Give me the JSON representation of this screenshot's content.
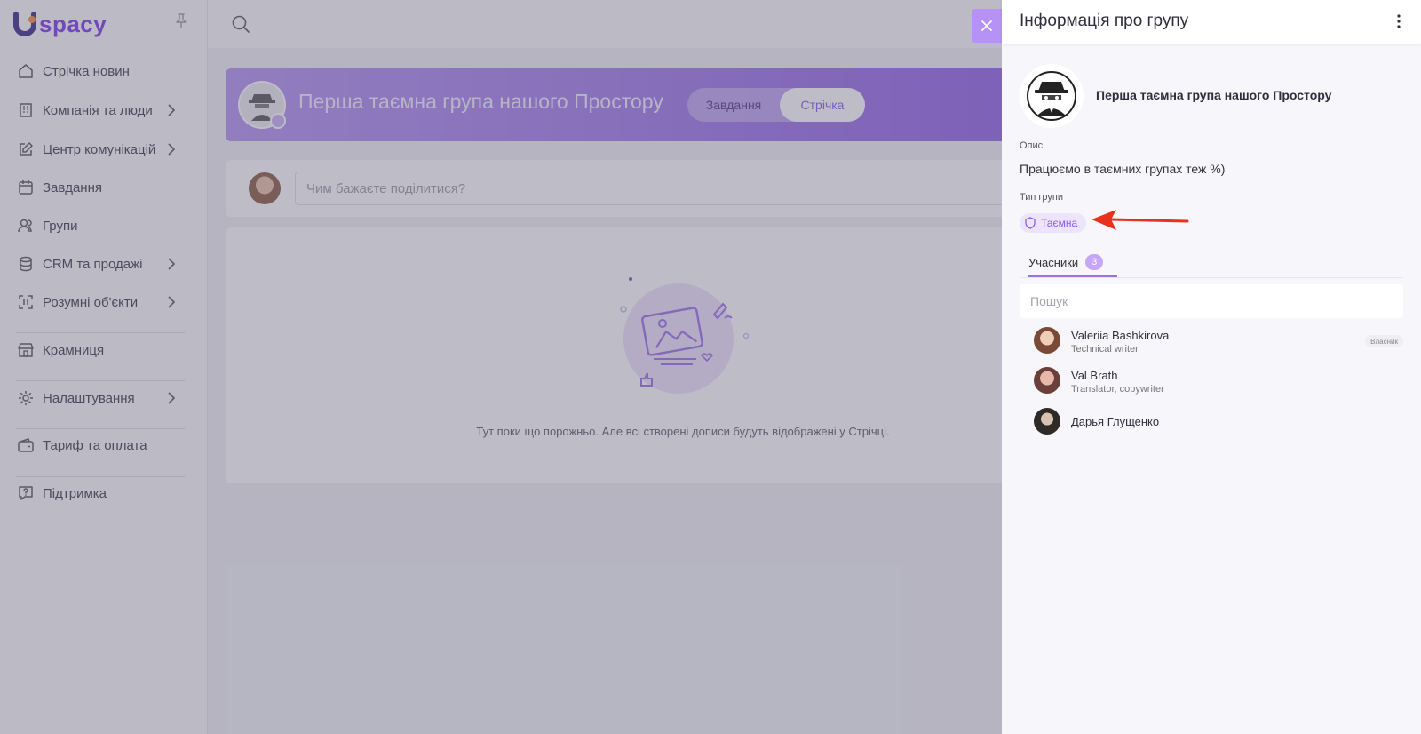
{
  "app": {
    "logo_text": "spacy"
  },
  "sidebar": {
    "items": [
      {
        "label": "Стрічка новин",
        "icon": "home-icon",
        "has_submenu": false
      },
      {
        "label": "Компанія та люди",
        "icon": "building-icon",
        "has_submenu": true
      },
      {
        "label": "Центр комунікацій",
        "icon": "edit-icon",
        "has_submenu": true
      },
      {
        "label": "Завдання",
        "icon": "calendar-icon",
        "has_submenu": false
      },
      {
        "label": "Групи",
        "icon": "users-icon",
        "has_submenu": false
      },
      {
        "label": "CRM та продажі",
        "icon": "database-icon",
        "has_submenu": true
      },
      {
        "label": "Розумні об'єкти",
        "icon": "scan-icon",
        "has_submenu": true
      },
      {
        "label": "Крамниця",
        "icon": "store-icon",
        "has_submenu": false
      },
      {
        "label": "Налаштування",
        "icon": "gear-icon",
        "has_submenu": true
      },
      {
        "label": "Тариф та оплата",
        "icon": "wallet-icon",
        "has_submenu": false
      },
      {
        "label": "Підтримка",
        "icon": "help-icon",
        "has_submenu": false
      }
    ]
  },
  "main": {
    "group_title": "Перша таємна група нашого Простору",
    "tabs": [
      {
        "label": "Завдання",
        "active": false
      },
      {
        "label": "Стрічка",
        "active": true
      }
    ],
    "post_placeholder": "Чим бажаєте поділитися?",
    "empty_text": "Тут поки що порожньо. Але всі створені дописи будуть відображені у Стрічці."
  },
  "panel": {
    "title": "Інформація про групу",
    "group_name": "Перша таємна група нашого Простору",
    "description_label": "Опис",
    "description": "Працюємо в таємних групах теж %)",
    "type_label": "Тип групи",
    "type_value": "Таємна",
    "members_tab": "Учасники",
    "members_count": "3",
    "search_placeholder": "Пошук",
    "members": [
      {
        "name": "Valeriia Bashkirova",
        "role": "Technical writer",
        "badge": "Власник"
      },
      {
        "name": "Val Brath",
        "role": "Translator, copywriter",
        "badge": ""
      },
      {
        "name": "Дарья Глущенко",
        "role": "",
        "badge": ""
      }
    ]
  },
  "colors": {
    "accent": "#8b5cf6",
    "banner_start": "#b394f2",
    "banner_end": "#8f62e6",
    "arrow": "#e8321d"
  }
}
